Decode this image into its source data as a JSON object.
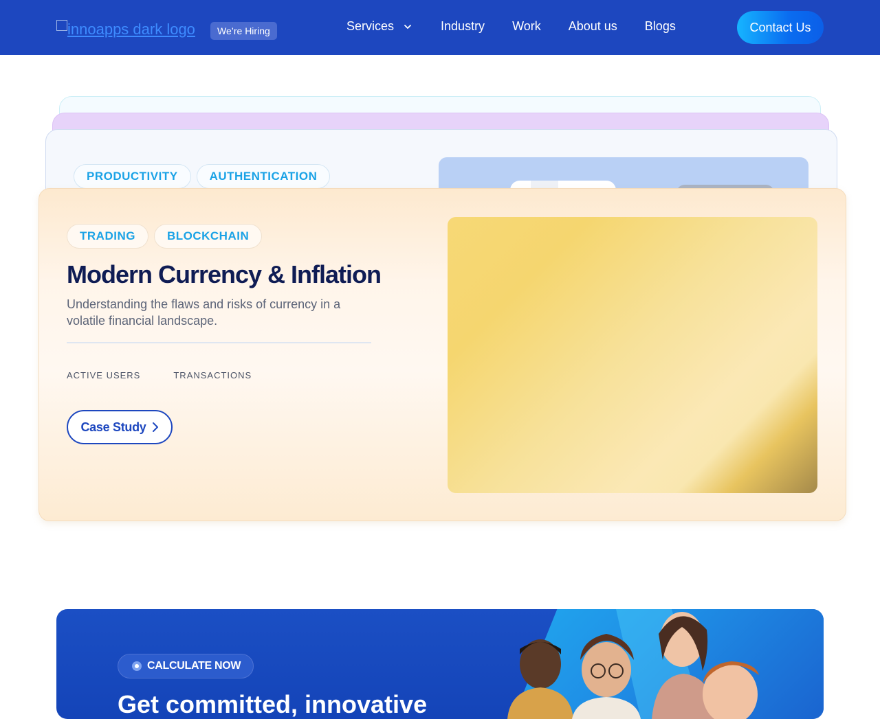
{
  "header": {
    "logo_alt": "innoapps dark logo",
    "hiring_badge": "We’re Hiring",
    "nav": [
      {
        "label": "Services",
        "has_dropdown": true
      },
      {
        "label": "Industry"
      },
      {
        "label": "Work"
      },
      {
        "label": "About us"
      },
      {
        "label": "Blogs"
      }
    ],
    "contact_button": "Contact Us"
  },
  "stacked_card": {
    "tags": [
      "PRODUCTIVITY",
      "AUTHENTICATION"
    ]
  },
  "case_study_card": {
    "tags": [
      "TRADING",
      "BLOCKCHAIN"
    ],
    "title": "Modern Currency & Inflation",
    "description": "Understanding the flaws and risks of currency in a volatile financial landscape.",
    "stats": [
      "ACTIVE USERS",
      "TRANSACTIONS"
    ],
    "button_label": "Case Study"
  },
  "banner": {
    "pill_label": "CALCULATE NOW",
    "heading": "Get committed, innovative"
  },
  "colors": {
    "header_bg": "#1d47bf",
    "accent": "#1aa2e6",
    "title": "#0f1c54",
    "banner_bg": "#1b4fc4"
  }
}
